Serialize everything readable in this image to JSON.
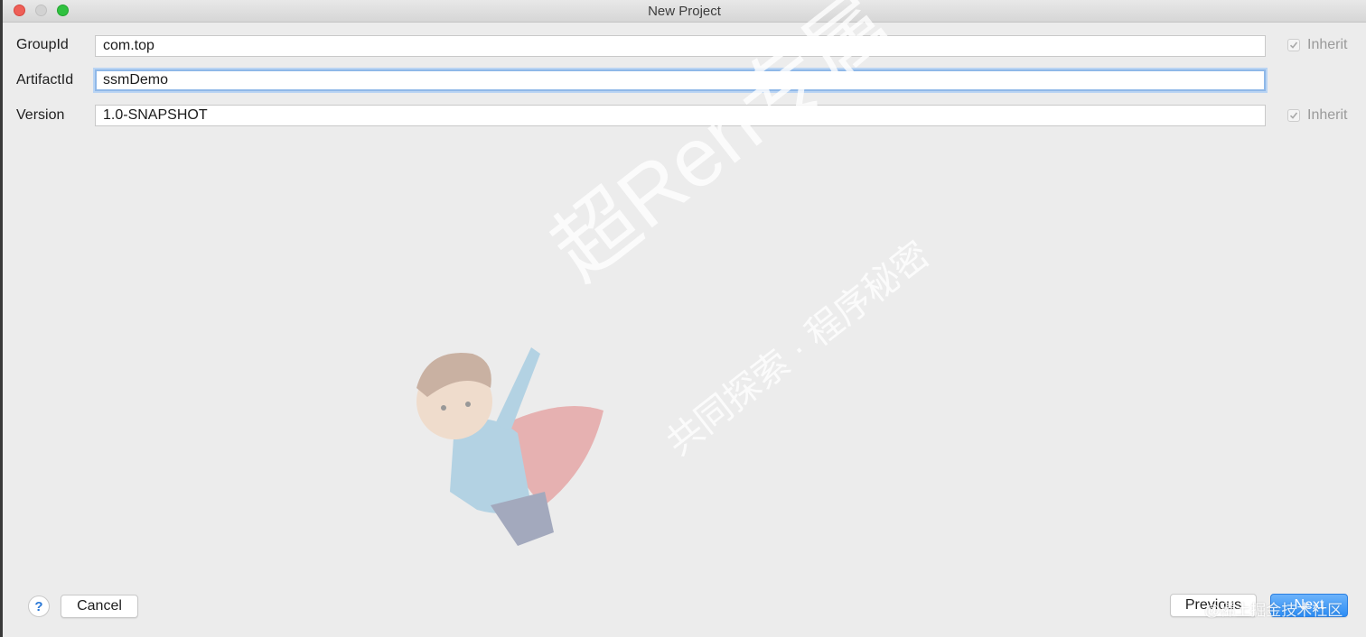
{
  "window": {
    "title": "New Project"
  },
  "form": {
    "groupId": {
      "label": "GroupId",
      "value": "com.top",
      "inherit_label": "Inherit",
      "inherit_checked": true
    },
    "artifactId": {
      "label": "ArtifactId",
      "value": "ssmDemo"
    },
    "version": {
      "label": "Version",
      "value": "1.0-SNAPSHOT",
      "inherit_label": "Inherit",
      "inherit_checked": true
    }
  },
  "buttons": {
    "help": "?",
    "cancel": "Cancel",
    "previous": "Previous",
    "next": "Next"
  },
  "watermark": {
    "line1": "超Ren专属",
    "line2": "共同探索 · 程序秘密",
    "footer": "@稀土掘金技术社区"
  },
  "colors": {
    "accent": "#2c8df5",
    "focus": "#8fb8e8",
    "background": "#ececec"
  }
}
